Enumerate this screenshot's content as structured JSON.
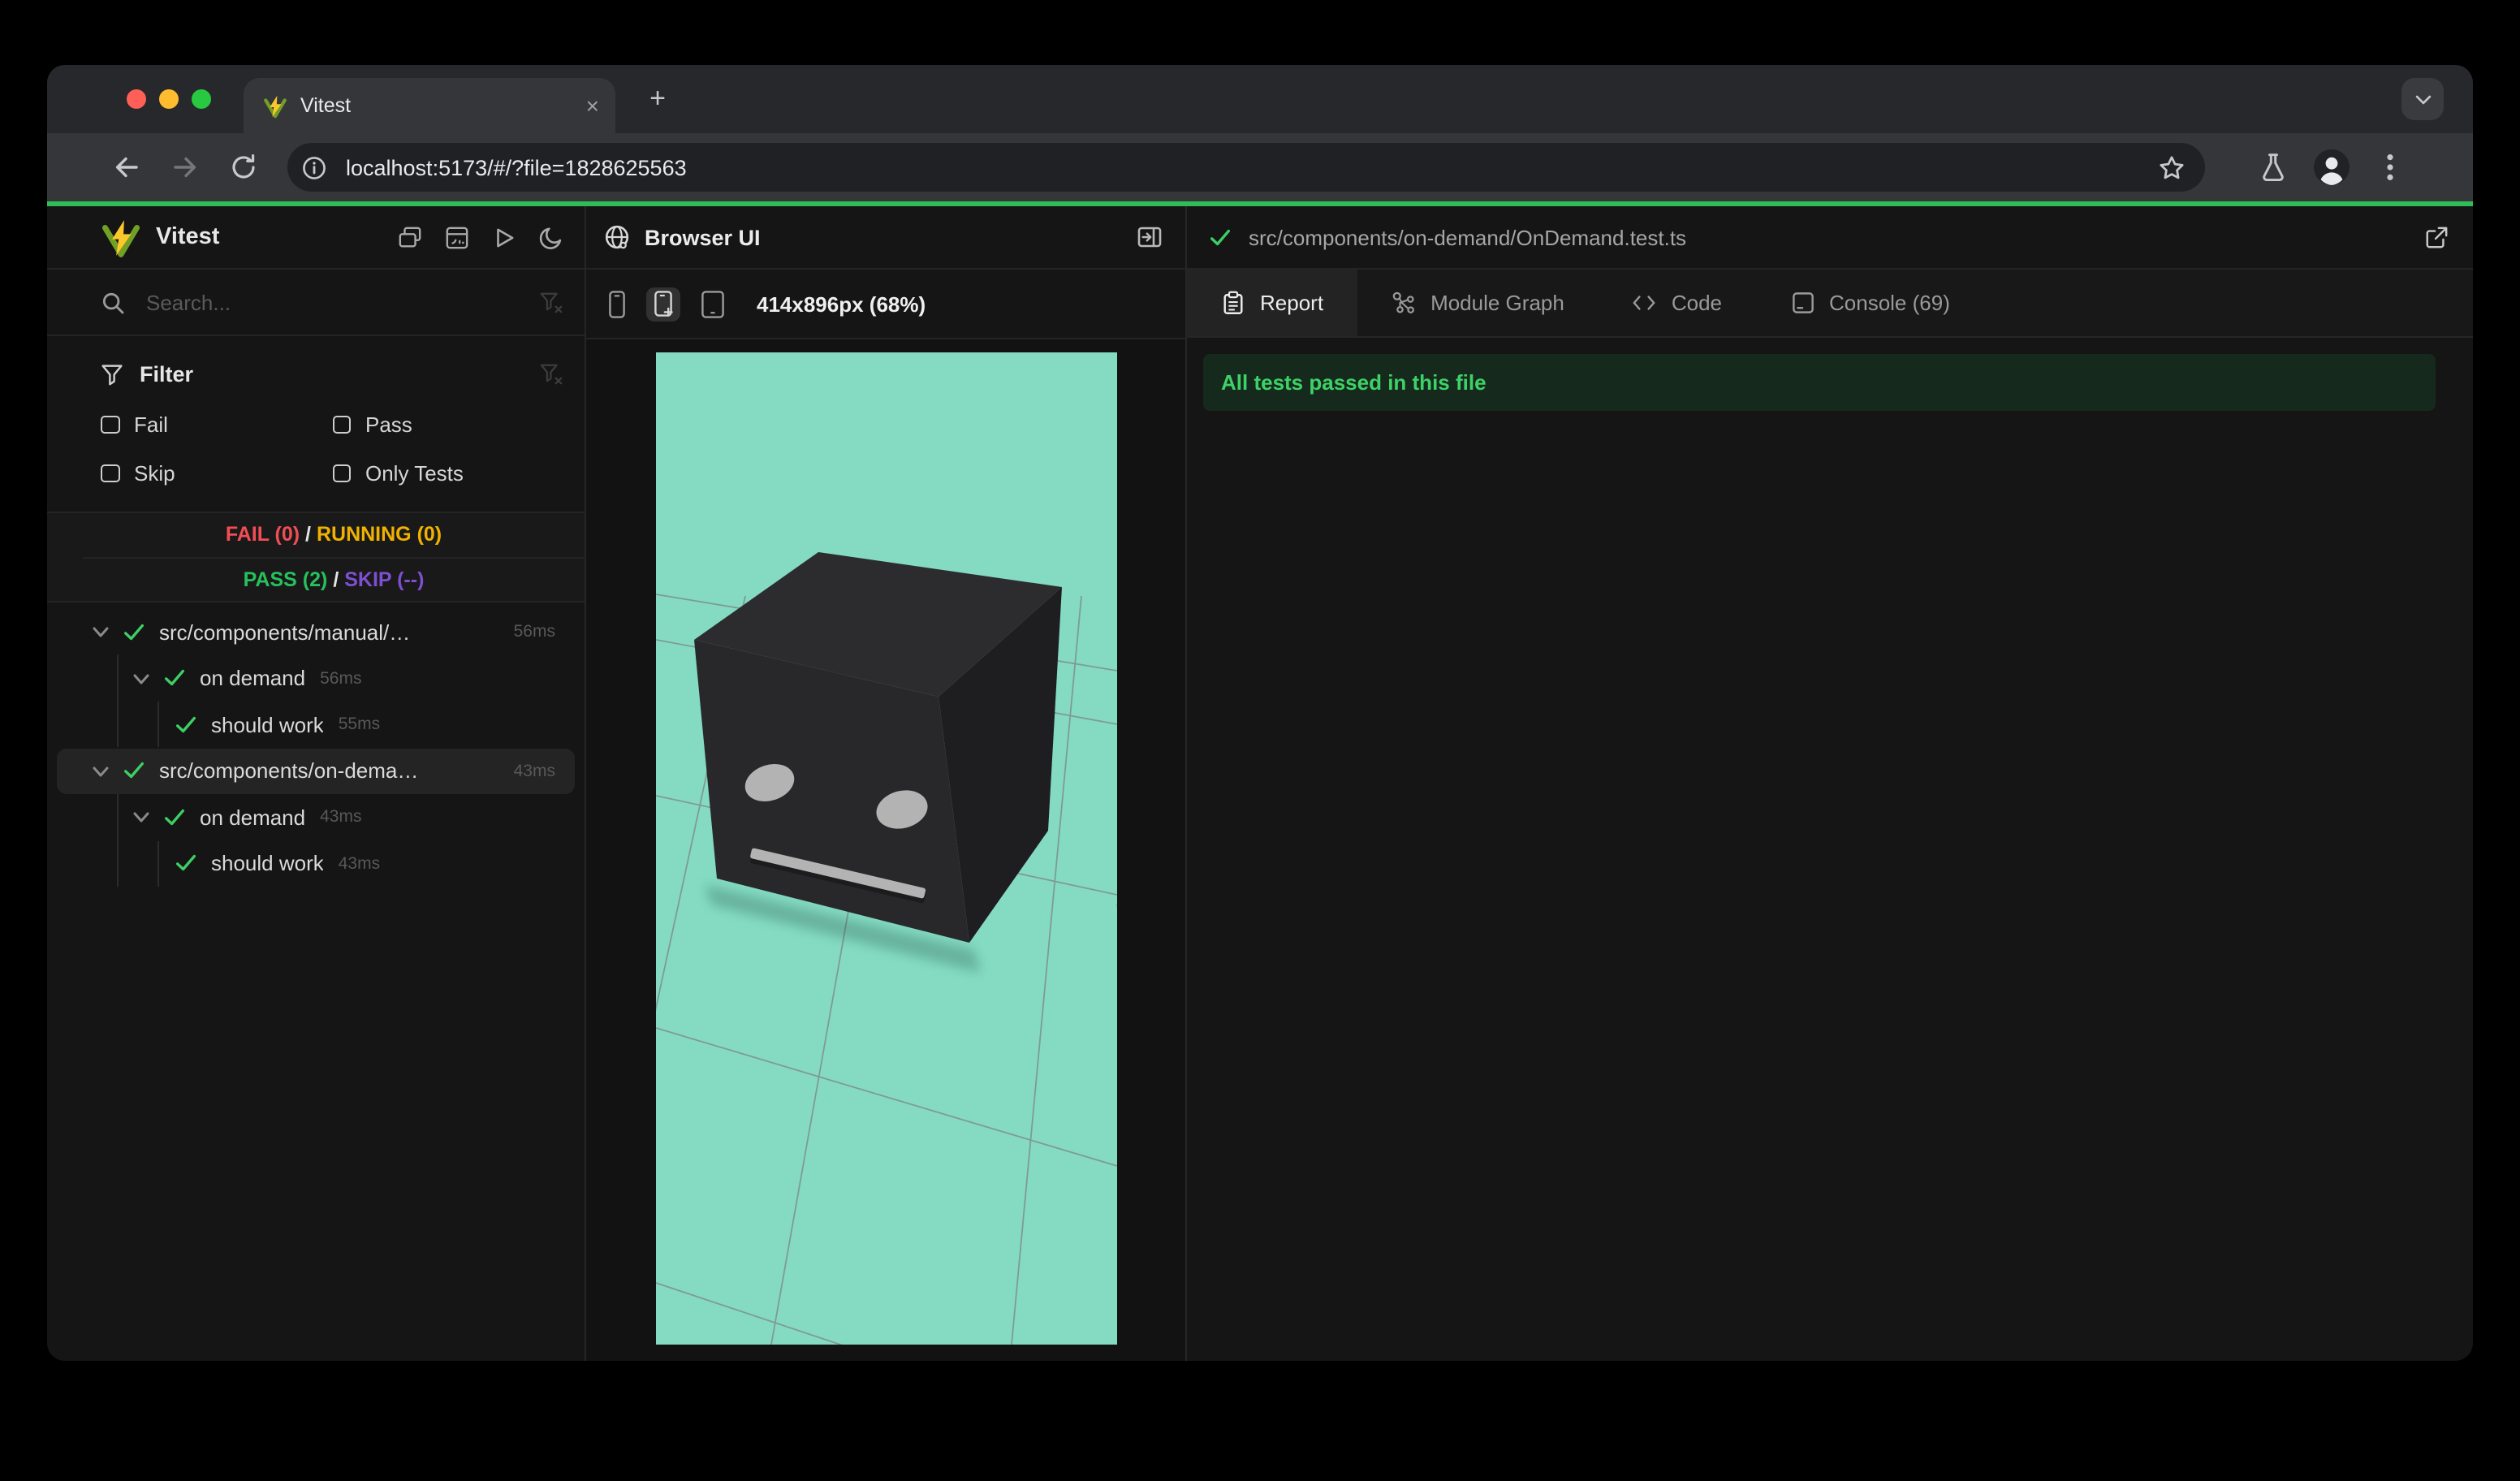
{
  "browser": {
    "tab_title": "Vitest",
    "close_tab": "×",
    "new_tab": "+",
    "url": "localhost:5173/#/?file=1828625563"
  },
  "sidebar": {
    "app_title": "Vitest",
    "search_placeholder": "Search...",
    "filter_title": "Filter",
    "filter_options": {
      "fail": "Fail",
      "pass": "Pass",
      "skip": "Skip",
      "only": "Only Tests"
    },
    "summary": {
      "fail": "FAIL (0)",
      "sep1": "/",
      "running": "RUNNING (0)",
      "pass": "PASS (2)",
      "sep2": "/",
      "skip": "SKIP (--)"
    },
    "tree": [
      {
        "label": "src/components/manual/…",
        "duration": "56ms"
      },
      {
        "label": "on demand",
        "duration": "56ms"
      },
      {
        "label": "should work",
        "duration": "55ms"
      },
      {
        "label": "src/components/on-dema…",
        "duration": "43ms"
      },
      {
        "label": "on demand",
        "duration": "43ms"
      },
      {
        "label": "should work",
        "duration": "43ms"
      }
    ]
  },
  "browser_panel": {
    "title": "Browser UI",
    "viewport": "414x896px (68%)"
  },
  "report_panel": {
    "file_path": "src/components/on-demand/OnDemand.test.ts",
    "tabs": {
      "report": "Report",
      "module_graph": "Module Graph",
      "code": "Code",
      "console": "Console (69)"
    },
    "banner": "All tests passed in this file"
  },
  "colors": {
    "accent_green": "#2fbe55",
    "pass_green": "#3ecf64",
    "fail_red": "#f24d55",
    "running_yellow": "#f0b100",
    "skip_purple": "#7e4fd1",
    "preview_bg": "#84dbc2",
    "banner_bg": "#15291c"
  }
}
